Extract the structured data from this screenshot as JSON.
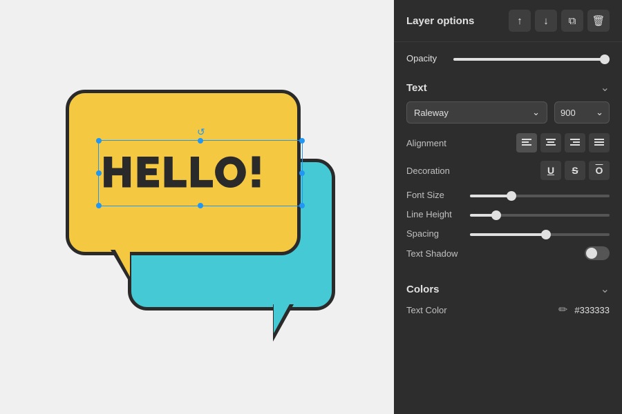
{
  "panel": {
    "layer_options_label": "Layer options",
    "opacity_label": "Opacity",
    "opacity_value": 100,
    "text_section": {
      "title": "Text",
      "font_family": "Raleway",
      "font_weight": "900",
      "alignment_label": "Alignment",
      "decoration_label": "Decoration",
      "font_size_label": "Font Size",
      "font_size_value": 62,
      "line_height_label": "Line Height",
      "line_height_value": 50,
      "spacing_label": "Spacing",
      "spacing_value": 55,
      "text_shadow_label": "Text Shadow",
      "text_shadow_on": false
    },
    "colors_section": {
      "title": "Colors",
      "text_color_label": "Text Color",
      "text_color_value": "#333333"
    },
    "icons": {
      "align_left": "≡",
      "align_center": "≡",
      "align_right": "≡",
      "align_justify": "≡",
      "underline": "U",
      "strikethrough": "S̶",
      "overline": "Ō",
      "chevron_down": "⌄",
      "move_up": "↑",
      "move_down": "↓",
      "copy": "⧉",
      "trash": "🗑"
    }
  },
  "canvas": {
    "hello_text": "HELLO!"
  }
}
